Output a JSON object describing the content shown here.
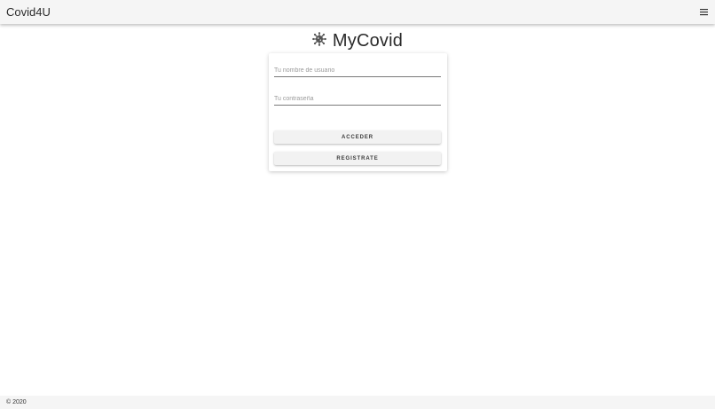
{
  "topbar": {
    "app_title": "Covid4U",
    "menu_icon": "hamburger-menu-icon"
  },
  "brand": {
    "logo_icon": "virus-icon",
    "title": "MyCovid"
  },
  "login_form": {
    "username": {
      "placeholder": "Tu nombre de usuario",
      "value": ""
    },
    "password": {
      "placeholder": "Tu contraseña",
      "value": ""
    },
    "access_label": "ACCEDER",
    "register_label": "REGISTRATE"
  },
  "footer": {
    "copyright": "© 2020"
  },
  "colors": {
    "bar_background": "#f5f5f5",
    "button_background": "#f2f2f2",
    "page_background": "#ffffff"
  }
}
